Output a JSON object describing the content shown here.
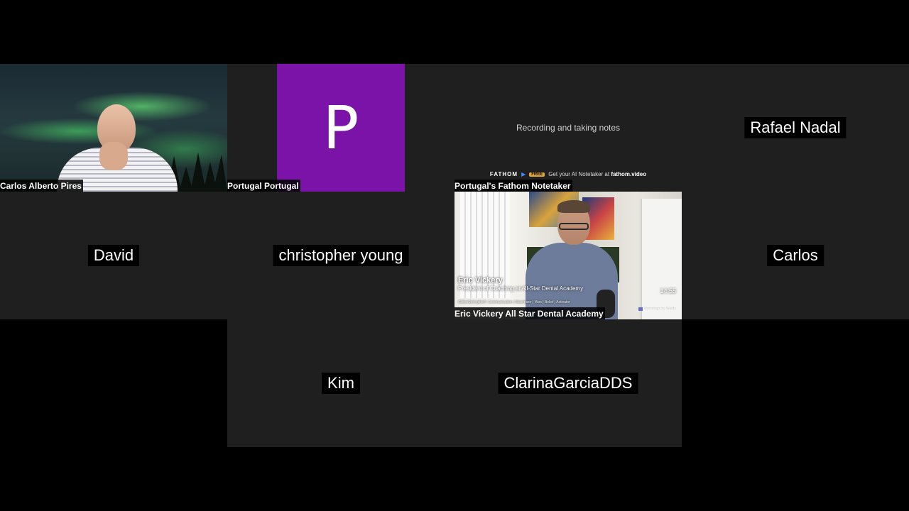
{
  "participants": {
    "carlos_alberto_pires": {
      "name": "Carlos Alberto Pires"
    },
    "portugal": {
      "name": "Portugal Portugal",
      "initial": "P",
      "avatar_color": "#7b13a9"
    },
    "fathom_notetaker": {
      "name": "Portugal's Fathom Notetaker",
      "status": "Recording and taking notes",
      "brand": "FATHOM",
      "badge": "FREE",
      "promo": "Get your AI Notetaker at",
      "domain": "fathom.video"
    },
    "rafael_nadal": {
      "name": "Rafael Nadal"
    },
    "david": {
      "name": "David"
    },
    "christopher_young": {
      "name": "christopher young"
    },
    "eric_vickery": {
      "name": "Eric Vickery All Star Dental Academy",
      "overlay_name": "Eric Vickery",
      "overlay_role": "President of Coaching at All-Star Dental Academy",
      "overlay_strengths": "CliftonStrengths®: Communication | Maximizer | Woo | Belief | Activator",
      "timer": "14:55",
      "watermark": "Nametags by Waldo"
    },
    "carlos": {
      "name": "Carlos"
    },
    "kim": {
      "name": "Kim"
    },
    "clarina": {
      "name": "ClarinaGarciaDDS"
    }
  },
  "icons": {
    "fathom_play": "play-icon",
    "nametag": "nametag-icon"
  },
  "colors": {
    "tile_background": "#1f1f1f",
    "page_background": "#000000",
    "fathom_accent": "#3d8bff",
    "free_badge": "#e3a72f"
  }
}
